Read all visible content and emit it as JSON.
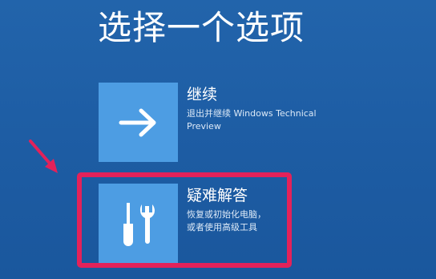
{
  "title": "选择一个选项",
  "options": [
    {
      "title": "继续",
      "description_lines": [
        "退出并继续 Windows Technical",
        "Preview"
      ],
      "icon": "arrow-right-icon"
    },
    {
      "title": "疑难解答",
      "description_lines": [
        "恢复或初始化电脑，",
        "或者使用高级工具"
      ],
      "icon": "tools-icon"
    }
  ],
  "colors": {
    "background": "#1e5fa6",
    "tile": "#4d9de3",
    "highlight": "#e3225a"
  }
}
